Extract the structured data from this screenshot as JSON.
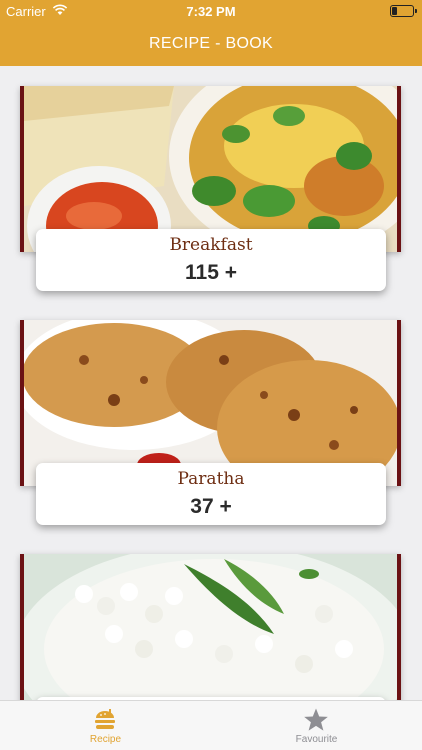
{
  "status_bar": {
    "carrier": "Carrier",
    "time": "7:32 PM"
  },
  "nav": {
    "title": "RECIPE - BOOK"
  },
  "categories": [
    {
      "name": "Breakfast",
      "count": "115 +"
    },
    {
      "name": "Paratha",
      "count": "37 +"
    },
    {
      "name": "",
      "count": ""
    }
  ],
  "tabs": [
    {
      "label": "Recipe",
      "icon": "burger-icon",
      "active": true
    },
    {
      "label": "Favourite",
      "icon": "star-icon",
      "active": false
    }
  ],
  "colors": {
    "accent": "#e1a432",
    "card_border": "#6b1214",
    "category_name": "#6e2e13"
  }
}
